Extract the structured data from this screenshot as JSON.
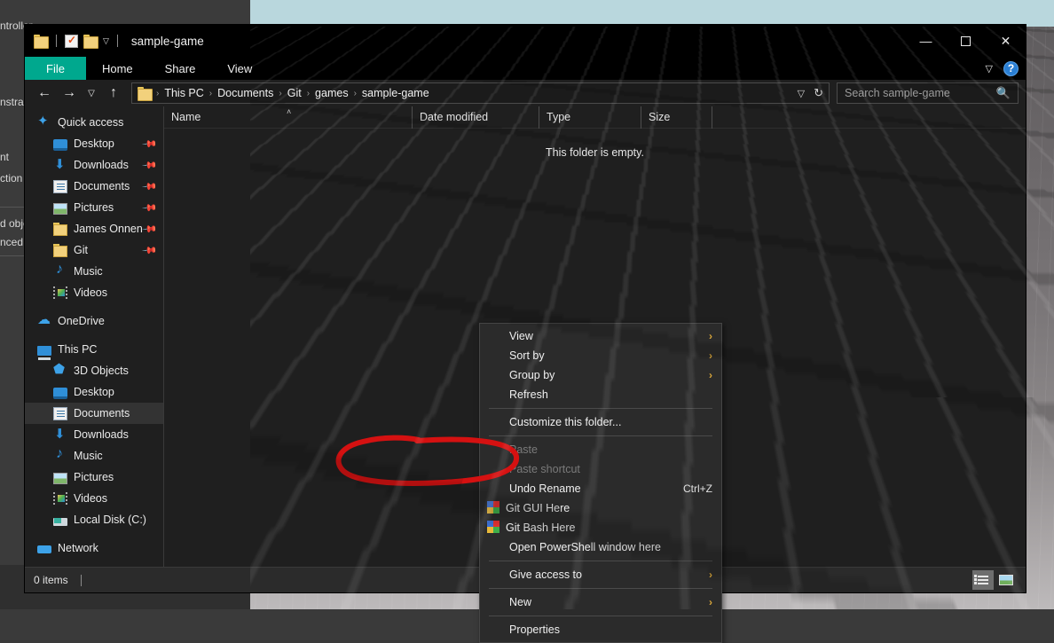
{
  "desktop": {
    "background_window_lines": [
      "ntroller",
      "nstrai",
      "nt",
      "ction",
      "d obje",
      "nced C"
    ],
    "wallpaper_sky_color": "#b9d7dd",
    "wallpaper_floor_color": "#7a7678"
  },
  "window": {
    "title": "sample-game",
    "quick_access_toolbar": [
      {
        "icon": "folder-icon",
        "name": "properties-folder"
      },
      {
        "icon": "properties-icon",
        "name": "properties"
      },
      {
        "icon": "new-folder-icon",
        "name": "new-folder"
      },
      {
        "icon": "chevron-down-icon",
        "name": "customize-quick-access"
      }
    ],
    "controls": {
      "minimize": "—",
      "maximize": "☐",
      "close": "✕"
    },
    "ribbon": {
      "tabs": [
        "File",
        "Home",
        "Share",
        "View"
      ],
      "active_tab": "File",
      "active_tab_color": "#00a88e",
      "collapse_label": "∨",
      "help_label": "?"
    },
    "navbar": {
      "back": "←",
      "forward": "→",
      "recent": "∨",
      "up": "↑",
      "breadcrumbs": [
        "This PC",
        "Documents",
        "Git",
        "games",
        "sample-game"
      ],
      "crumb_separator": "›",
      "dropdown": "∨",
      "refresh": "↻"
    },
    "search": {
      "placeholder": "Search sample-game",
      "value": "",
      "icon": "search-icon"
    }
  },
  "sidebar": {
    "groups": [
      {
        "label": "Quick access",
        "icon": "star-icon",
        "level": 0,
        "items": [
          {
            "label": "Desktop",
            "icon": "monitor-icon",
            "pinned": true
          },
          {
            "label": "Downloads",
            "icon": "download-arrow-icon",
            "pinned": true
          },
          {
            "label": "Documents",
            "icon": "document-icon",
            "pinned": true
          },
          {
            "label": "Pictures",
            "icon": "picture-icon",
            "pinned": true
          },
          {
            "label": "James Onnen",
            "icon": "folder-icon",
            "pinned": true
          },
          {
            "label": "Git",
            "icon": "folder-icon",
            "pinned": true
          },
          {
            "label": "Music",
            "icon": "music-note-icon",
            "pinned": false
          },
          {
            "label": "Videos",
            "icon": "video-icon",
            "pinned": false
          }
        ]
      },
      {
        "label": "OneDrive",
        "icon": "cloud-icon",
        "level": 0,
        "items": []
      },
      {
        "label": "This PC",
        "icon": "computer-icon",
        "level": 0,
        "items": [
          {
            "label": "3D Objects",
            "icon": "cube-icon",
            "pinned": false
          },
          {
            "label": "Desktop",
            "icon": "monitor-icon",
            "pinned": false
          },
          {
            "label": "Documents",
            "icon": "document-icon",
            "pinned": false,
            "selected": true
          },
          {
            "label": "Downloads",
            "icon": "download-arrow-icon",
            "pinned": false
          },
          {
            "label": "Music",
            "icon": "music-note-icon",
            "pinned": false
          },
          {
            "label": "Pictures",
            "icon": "picture-icon",
            "pinned": false
          },
          {
            "label": "Videos",
            "icon": "video-icon",
            "pinned": false
          },
          {
            "label": "Local Disk (C:)",
            "icon": "disk-icon",
            "pinned": false
          }
        ]
      },
      {
        "label": "Network",
        "icon": "network-icon",
        "level": 0,
        "items": []
      }
    ]
  },
  "filelist": {
    "columns": [
      {
        "label": "Name",
        "sorted": true,
        "sort_caret": "˄"
      },
      {
        "label": "Date modified"
      },
      {
        "label": "Type"
      },
      {
        "label": "Size"
      }
    ],
    "rows": [],
    "empty_message": "This folder is empty."
  },
  "context_menu": {
    "items": [
      {
        "label": "View",
        "submenu": true,
        "arrow": "›"
      },
      {
        "label": "Sort by",
        "submenu": true,
        "arrow": "›"
      },
      {
        "label": "Group by",
        "submenu": true,
        "arrow": "›"
      },
      {
        "label": "Refresh"
      },
      {
        "separator": true
      },
      {
        "label": "Customize this folder..."
      },
      {
        "separator": true
      },
      {
        "label": "Paste",
        "disabled": true
      },
      {
        "label": "Paste shortcut",
        "disabled": true
      },
      {
        "label": "Undo Rename",
        "accel": "Ctrl+Z"
      },
      {
        "label": "Git GUI Here",
        "icon": "git-icon"
      },
      {
        "label": "Git Bash Here",
        "icon": "git-icon"
      },
      {
        "label": "Open PowerShell window here"
      },
      {
        "separator": true
      },
      {
        "label": "Give access to",
        "submenu": true,
        "arrow": "›"
      },
      {
        "separator": true
      },
      {
        "label": "New",
        "submenu": true,
        "arrow": "›"
      },
      {
        "separator": true
      },
      {
        "label": "Properties"
      }
    ]
  },
  "annotation": {
    "type": "hand-drawn-ellipse",
    "color": "#d51111",
    "target": "Open PowerShell window here"
  },
  "statusbar": {
    "item_count": "0 items",
    "view_buttons": [
      {
        "name": "details-view",
        "active": true
      },
      {
        "name": "large-icons-view",
        "active": false
      }
    ]
  }
}
